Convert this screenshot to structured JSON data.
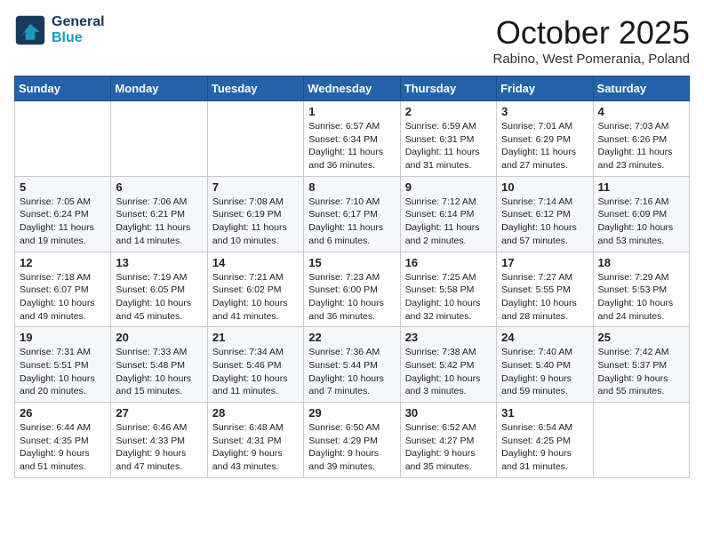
{
  "header": {
    "logo_line1": "General",
    "logo_line2": "Blue",
    "month": "October 2025",
    "location": "Rabino, West Pomerania, Poland"
  },
  "weekdays": [
    "Sunday",
    "Monday",
    "Tuesday",
    "Wednesday",
    "Thursday",
    "Friday",
    "Saturday"
  ],
  "weeks": [
    [
      {
        "day": "",
        "content": ""
      },
      {
        "day": "",
        "content": ""
      },
      {
        "day": "",
        "content": ""
      },
      {
        "day": "1",
        "content": "Sunrise: 6:57 AM\nSunset: 6:34 PM\nDaylight: 11 hours and 36 minutes."
      },
      {
        "day": "2",
        "content": "Sunrise: 6:59 AM\nSunset: 6:31 PM\nDaylight: 11 hours and 31 minutes."
      },
      {
        "day": "3",
        "content": "Sunrise: 7:01 AM\nSunset: 6:29 PM\nDaylight: 11 hours and 27 minutes."
      },
      {
        "day": "4",
        "content": "Sunrise: 7:03 AM\nSunset: 6:26 PM\nDaylight: 11 hours and 23 minutes."
      }
    ],
    [
      {
        "day": "5",
        "content": "Sunrise: 7:05 AM\nSunset: 6:24 PM\nDaylight: 11 hours and 19 minutes."
      },
      {
        "day": "6",
        "content": "Sunrise: 7:06 AM\nSunset: 6:21 PM\nDaylight: 11 hours and 14 minutes."
      },
      {
        "day": "7",
        "content": "Sunrise: 7:08 AM\nSunset: 6:19 PM\nDaylight: 11 hours and 10 minutes."
      },
      {
        "day": "8",
        "content": "Sunrise: 7:10 AM\nSunset: 6:17 PM\nDaylight: 11 hours and 6 minutes."
      },
      {
        "day": "9",
        "content": "Sunrise: 7:12 AM\nSunset: 6:14 PM\nDaylight: 11 hours and 2 minutes."
      },
      {
        "day": "10",
        "content": "Sunrise: 7:14 AM\nSunset: 6:12 PM\nDaylight: 10 hours and 57 minutes."
      },
      {
        "day": "11",
        "content": "Sunrise: 7:16 AM\nSunset: 6:09 PM\nDaylight: 10 hours and 53 minutes."
      }
    ],
    [
      {
        "day": "12",
        "content": "Sunrise: 7:18 AM\nSunset: 6:07 PM\nDaylight: 10 hours and 49 minutes."
      },
      {
        "day": "13",
        "content": "Sunrise: 7:19 AM\nSunset: 6:05 PM\nDaylight: 10 hours and 45 minutes."
      },
      {
        "day": "14",
        "content": "Sunrise: 7:21 AM\nSunset: 6:02 PM\nDaylight: 10 hours and 41 minutes."
      },
      {
        "day": "15",
        "content": "Sunrise: 7:23 AM\nSunset: 6:00 PM\nDaylight: 10 hours and 36 minutes."
      },
      {
        "day": "16",
        "content": "Sunrise: 7:25 AM\nSunset: 5:58 PM\nDaylight: 10 hours and 32 minutes."
      },
      {
        "day": "17",
        "content": "Sunrise: 7:27 AM\nSunset: 5:55 PM\nDaylight: 10 hours and 28 minutes."
      },
      {
        "day": "18",
        "content": "Sunrise: 7:29 AM\nSunset: 5:53 PM\nDaylight: 10 hours and 24 minutes."
      }
    ],
    [
      {
        "day": "19",
        "content": "Sunrise: 7:31 AM\nSunset: 5:51 PM\nDaylight: 10 hours and 20 minutes."
      },
      {
        "day": "20",
        "content": "Sunrise: 7:33 AM\nSunset: 5:48 PM\nDaylight: 10 hours and 15 minutes."
      },
      {
        "day": "21",
        "content": "Sunrise: 7:34 AM\nSunset: 5:46 PM\nDaylight: 10 hours and 11 minutes."
      },
      {
        "day": "22",
        "content": "Sunrise: 7:36 AM\nSunset: 5:44 PM\nDaylight: 10 hours and 7 minutes."
      },
      {
        "day": "23",
        "content": "Sunrise: 7:38 AM\nSunset: 5:42 PM\nDaylight: 10 hours and 3 minutes."
      },
      {
        "day": "24",
        "content": "Sunrise: 7:40 AM\nSunset: 5:40 PM\nDaylight: 9 hours and 59 minutes."
      },
      {
        "day": "25",
        "content": "Sunrise: 7:42 AM\nSunset: 5:37 PM\nDaylight: 9 hours and 55 minutes."
      }
    ],
    [
      {
        "day": "26",
        "content": "Sunrise: 6:44 AM\nSunset: 4:35 PM\nDaylight: 9 hours and 51 minutes."
      },
      {
        "day": "27",
        "content": "Sunrise: 6:46 AM\nSunset: 4:33 PM\nDaylight: 9 hours and 47 minutes."
      },
      {
        "day": "28",
        "content": "Sunrise: 6:48 AM\nSunset: 4:31 PM\nDaylight: 9 hours and 43 minutes."
      },
      {
        "day": "29",
        "content": "Sunrise: 6:50 AM\nSunset: 4:29 PM\nDaylight: 9 hours and 39 minutes."
      },
      {
        "day": "30",
        "content": "Sunrise: 6:52 AM\nSunset: 4:27 PM\nDaylight: 9 hours and 35 minutes."
      },
      {
        "day": "31",
        "content": "Sunrise: 6:54 AM\nSunset: 4:25 PM\nDaylight: 9 hours and 31 minutes."
      },
      {
        "day": "",
        "content": ""
      }
    ]
  ]
}
